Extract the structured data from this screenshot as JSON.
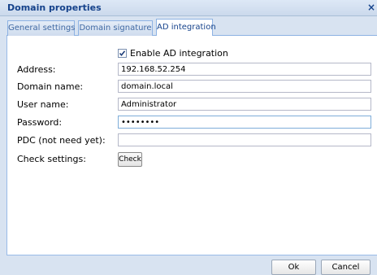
{
  "window": {
    "title": "Domain properties",
    "close_symbol": "×"
  },
  "tabs": [
    {
      "label": "General settings",
      "active": false
    },
    {
      "label": "Domain signature",
      "active": false
    },
    {
      "label": "AD integration",
      "active": true
    }
  ],
  "form": {
    "enable_ad": {
      "label": "Enable AD integration",
      "checked": true
    },
    "address": {
      "label": "Address:",
      "value": "192.168.52.254"
    },
    "domain_name": {
      "label": "Domain name:",
      "value": "domain.local"
    },
    "user_name": {
      "label": "User name:",
      "value": "Administrator"
    },
    "password": {
      "label": "Password:",
      "value": "••••••••"
    },
    "pdc": {
      "label": "PDC (not need yet):",
      "value": ""
    },
    "check_settings": {
      "label": "Check settings:",
      "button_label": "Check"
    }
  },
  "footer": {
    "ok_label": "Ok",
    "cancel_label": "Cancel"
  },
  "colors": {
    "title_text": "#15428b",
    "window_bg": "#d8e3f1",
    "tab_border": "#8db2e3"
  }
}
